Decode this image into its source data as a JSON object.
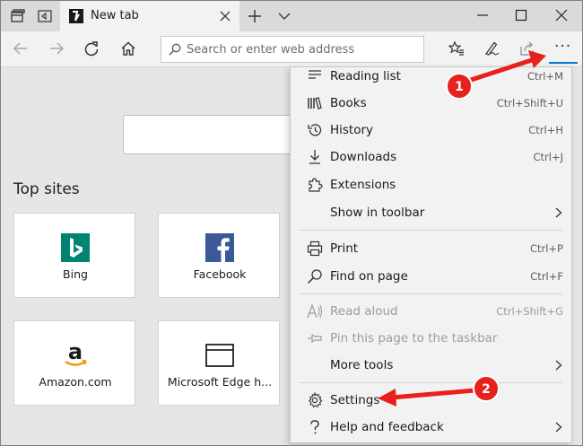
{
  "colors": {
    "accent": "#0078d7",
    "annotation": "#e8211d",
    "bing": "#008373",
    "facebook": "#3b5998"
  },
  "tab": {
    "title": "New tab",
    "icon": "edge-logo-icon"
  },
  "addressbar": {
    "placeholder": "Search or enter web address",
    "icon": "search-icon"
  },
  "ntp": {
    "top_sites_title": "Top sites",
    "tiles": [
      {
        "label": "Bing",
        "icon": "bing-logo-icon"
      },
      {
        "label": "Facebook",
        "icon": "facebook-logo-icon"
      },
      {
        "label": "Amazon.com",
        "icon": "amazon-logo-icon"
      },
      {
        "label": "Microsoft Edge h...",
        "icon": "browser-window-icon"
      }
    ]
  },
  "menu": {
    "items": [
      {
        "label": "Reading list",
        "shortcut": "Ctrl+M",
        "icon": "reading-list-icon"
      },
      {
        "label": "Books",
        "shortcut": "Ctrl+Shift+U",
        "icon": "books-icon"
      },
      {
        "label": "History",
        "shortcut": "Ctrl+H",
        "icon": "history-icon"
      },
      {
        "label": "Downloads",
        "shortcut": "Ctrl+J",
        "icon": "download-icon"
      },
      {
        "label": "Extensions",
        "shortcut": "",
        "icon": "extensions-icon"
      },
      {
        "label": "Show in toolbar",
        "shortcut": "",
        "icon": "chevron-right-icon"
      },
      {
        "label": "Print",
        "shortcut": "Ctrl+P",
        "icon": "print-icon"
      },
      {
        "label": "Find on page",
        "shortcut": "Ctrl+F",
        "icon": "search-icon"
      },
      {
        "label": "Read aloud",
        "shortcut": "Ctrl+Shift+G",
        "icon": "read-aloud-icon",
        "disabled": true
      },
      {
        "label": "Pin this page to the taskbar",
        "shortcut": "",
        "icon": "pin-icon",
        "disabled": true
      },
      {
        "label": "More tools",
        "shortcut": "",
        "icon": "chevron-right-icon"
      },
      {
        "label": "Settings",
        "shortcut": "",
        "icon": "gear-icon"
      },
      {
        "label": "Help and feedback",
        "shortcut": "",
        "icon": "help-icon"
      }
    ]
  },
  "annotations": {
    "badge_1": "1",
    "badge_2": "2"
  }
}
